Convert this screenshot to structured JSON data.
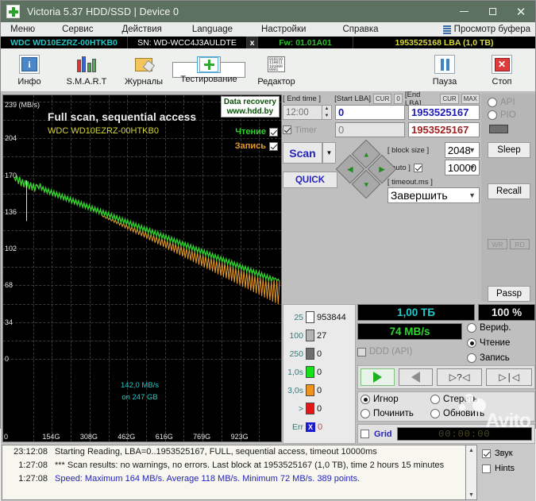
{
  "window": {
    "title": "Victoria 5.37 HDD/SSD | Device 0",
    "logo_icon": "green-cross-icon",
    "minimize": "minimize-icon",
    "maximize": "maximize-icon",
    "close": "close-icon"
  },
  "menubar": {
    "items": [
      "Меню",
      "Сервис",
      "Действия",
      "Language",
      "Настройки",
      "Справка"
    ],
    "buffer_label": "Просмотр буфера",
    "buffer_icon": "list-icon"
  },
  "devicebar": {
    "model": "WDC WD10EZRZ-00HTKB0",
    "serial": "SN: WD-WCC4J3AULDTE",
    "close_x": "x",
    "firmware": "Fw: 01.01A01",
    "capacity": "1953525168 LBA (1,0 TB)"
  },
  "toolbar": {
    "items": [
      {
        "label": "Инфо",
        "icon": "info-icon"
      },
      {
        "label": "S.M.A.R.T",
        "icon": "smart-bars-icon"
      },
      {
        "label": "Журналы",
        "icon": "folder-edit-icon"
      },
      {
        "label": "Тестирование",
        "icon": "test-cross-icon"
      },
      {
        "label": "Редактор",
        "icon": "hex-editor-icon"
      }
    ],
    "pause": {
      "label": "Пауза",
      "icon": "pause-icon"
    },
    "stop": {
      "label": "Стоп",
      "icon": "stop-x-icon"
    }
  },
  "chart_data": {
    "type": "line",
    "title": "Full scan, sequential access",
    "subtitle": "WDC WD10EZRZ-00HTKB0",
    "ylabel": "239 (MB/s)",
    "xlabel": "",
    "yticks": [
      "239 (MB/s)",
      "204",
      "170",
      "136",
      "102",
      "68",
      "34",
      "0"
    ],
    "yvalues": [
      239,
      204,
      170,
      136,
      102,
      68,
      34,
      0
    ],
    "xticks": [
      "0",
      "154G",
      "308G",
      "462G",
      "616G",
      "769G",
      "923G"
    ],
    "ylim": [
      0,
      239
    ],
    "grid": true,
    "legend_position": "top-right",
    "series": [
      {
        "name": "Чтение",
        "color": "#2fd42f",
        "checked": true
      },
      {
        "name": "Запись",
        "color": "#e59a2a",
        "checked": true
      }
    ],
    "points": [
      168,
      166,
      170,
      163,
      169,
      161,
      167,
      160,
      166,
      159,
      165,
      158,
      164,
      157,
      163,
      156,
      162,
      161,
      158,
      163,
      157,
      160,
      155,
      159,
      154,
      158,
      153,
      157,
      152,
      156,
      151,
      155,
      150,
      154,
      149,
      153,
      148,
      152,
      147,
      151,
      146,
      150,
      145,
      149,
      144,
      148,
      143,
      147,
      142,
      146,
      141,
      145,
      140,
      144,
      139,
      143,
      138,
      142,
      137,
      141,
      136,
      140,
      135,
      139,
      134,
      138,
      133,
      137,
      132,
      136,
      131,
      135,
      130,
      134,
      129,
      133,
      128,
      132,
      127,
      131,
      126,
      130,
      125,
      129,
      124,
      128,
      123,
      127,
      122,
      126,
      121,
      125,
      120,
      124,
      119,
      123,
      118,
      122,
      117,
      121,
      116,
      120,
      115,
      119,
      114,
      118,
      113,
      117,
      112,
      116,
      111,
      115,
      110,
      114,
      109,
      113,
      108,
      112,
      107,
      111,
      106,
      110,
      105,
      109,
      104,
      108,
      103,
      107,
      102,
      106,
      101,
      105,
      100,
      104,
      99,
      103,
      98,
      102,
      97,
      101,
      96,
      100,
      95,
      99,
      94,
      98,
      93,
      97,
      92,
      96,
      91,
      95,
      90,
      94,
      89,
      93,
      88,
      92,
      87,
      91,
      86,
      90,
      85,
      89,
      84,
      88,
      83,
      87,
      82,
      86,
      81,
      85,
      80,
      84,
      79,
      83,
      78,
      82,
      77,
      81,
      76,
      80,
      75,
      79,
      74,
      78,
      73,
      77,
      72,
      76,
      74,
      75,
      73,
      74,
      72
    ],
    "annotation": {
      "line1": "142,0 MB/s",
      "line2": "on 247 GB"
    },
    "badge": {
      "line1": "Data recovery",
      "line2": "www.hdd.by"
    }
  },
  "controls": {
    "end_time_label": "[ End time ]",
    "end_time_value": "12:00",
    "timer_label": "Timer",
    "timer_checked": true,
    "start_lba_label": "[Start LBA]",
    "start_lba_cur": "CUR",
    "start_lba_zero": "0",
    "start_lba_value": "0",
    "start_lba_value2": "0",
    "end_lba_label": "[End LBA]",
    "end_lba_cur": "CUR",
    "end_lba_max": "MAX",
    "end_lba_value": "1953525167",
    "end_lba_value2": "1953525167",
    "scan_button": "Scan",
    "scan_dropdown_icon": "chevron-down-icon",
    "quick_button": "QUICK",
    "dpad": {
      "up": "arrow-up-icon",
      "down": "arrow-down-icon",
      "left": "arrow-left-icon",
      "right": "arrow-right-icon"
    },
    "block_size_label": "[ block size ]",
    "block_size_value": "2048",
    "auto_label": "[ auto ]",
    "auto_checked": true,
    "timeout_label": "[ timeout.ms ]",
    "timeout_value": "10000",
    "finish_action": "Завершить"
  },
  "stats": {
    "rows": [
      {
        "key": "25",
        "color": "#ffffff",
        "value": "953844"
      },
      {
        "key": "100",
        "color": "#b4b4b4",
        "value": "27"
      },
      {
        "key": "250",
        "color": "#6e6e6e",
        "value": "0"
      },
      {
        "key": "1,0s",
        "color": "#18e018",
        "value": "0"
      },
      {
        "key": "3,0s",
        "color": "#f0921e",
        "value": "0"
      },
      {
        "key": ">",
        "color": "#e01818",
        "value": "0"
      },
      {
        "key": "Err",
        "color": "#1a1ad0",
        "value": "0",
        "is_error": true
      }
    ]
  },
  "readout": {
    "capacity": "1,00 ТБ",
    "percent": "100  %",
    "speed": "74 MB/s",
    "ddd_label": "DDD (API)",
    "ddd_checked": false,
    "modes": [
      {
        "label": "Вериф.",
        "selected": false
      },
      {
        "label": "Чтение",
        "selected": true
      },
      {
        "label": "Запись",
        "selected": false
      }
    ],
    "transport": [
      {
        "icon": "play-icon",
        "label": ""
      },
      {
        "icon": "rewind-icon",
        "label": ""
      },
      {
        "icon": "step-query-icon",
        "label": "?"
      },
      {
        "icon": "skip-start-icon",
        "label": ""
      }
    ],
    "actions": [
      {
        "label": "Игнор",
        "selected": true
      },
      {
        "label": "Стереть",
        "selected": false
      },
      {
        "label": "Починить",
        "selected": false
      },
      {
        "label": "Обновить",
        "selected": false
      }
    ],
    "grid_label": "Grid",
    "grid_checked": false,
    "timer_display": "00:00:00"
  },
  "sidebar": {
    "api_label": "API",
    "pio_label": "PIO",
    "sleep_button": "Sleep",
    "recall_button": "Recall",
    "wr_button": "WR",
    "rd_button": "RD",
    "passp_button": "Passp"
  },
  "log": {
    "entries": [
      {
        "time": "23:12:08",
        "text": "Starting Reading, LBA=0..1953525167, FULL, sequential access, timeout 10000ms",
        "color": "black"
      },
      {
        "time": "1:27:08",
        "text": "*** Scan results: no warnings, no errors. Last block at 1953525167 (1,0 TB), time 2 hours 15 minutes",
        "color": "black"
      },
      {
        "time": "1:27:08",
        "text": "Speed: Maximum 164 MB/s. Average 118 MB/s. Minimum 72 MB/s. 389 points.",
        "color": "blue"
      }
    ],
    "options": [
      {
        "label": "Звук",
        "checked": true
      },
      {
        "label": "Hints",
        "checked": false
      }
    ],
    "watermark": "Avito",
    "scroll_up": "scroll-up-icon",
    "scroll_down": "scroll-down-icon"
  }
}
